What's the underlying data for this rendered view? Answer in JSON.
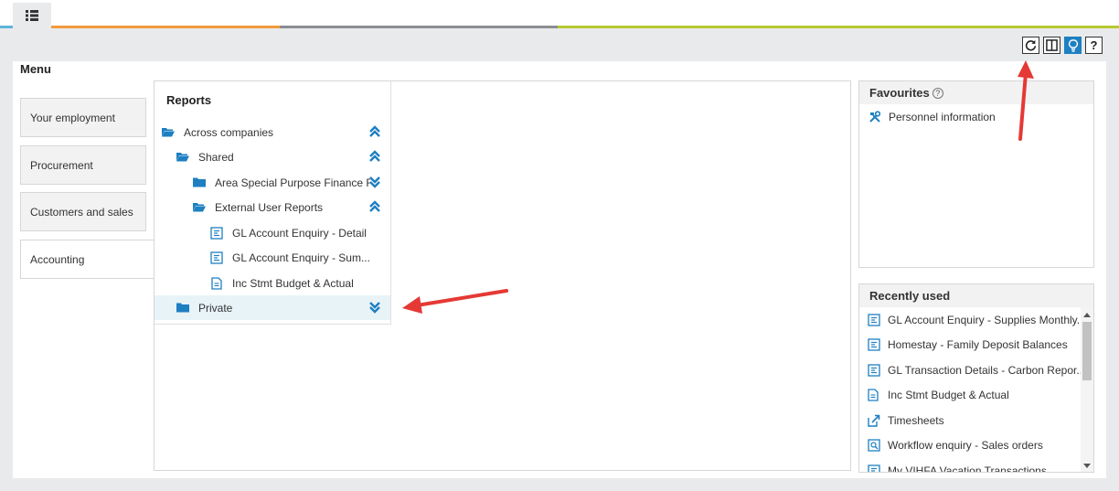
{
  "menu": {
    "title": "Menu"
  },
  "nav": {
    "items": [
      {
        "label": "Your employment"
      },
      {
        "label": "Procurement"
      },
      {
        "label": "Customers and sales"
      },
      {
        "label": "Accounting"
      }
    ],
    "active": "Accounting"
  },
  "reports": {
    "title": "Reports",
    "tree": [
      {
        "label": "Across companies",
        "type": "folder-open",
        "chevron": "up"
      },
      {
        "label": "Shared",
        "type": "folder-open",
        "chevron": "up"
      },
      {
        "label": "Area Special Purpose Finance R...",
        "type": "folder",
        "chevron": "down"
      },
      {
        "label": "External User Reports",
        "type": "folder-open",
        "chevron": "up"
      },
      {
        "label": "GL Account Enquiry - Detail",
        "type": "report"
      },
      {
        "label": "GL Account Enquiry - Sum...",
        "type": "report"
      },
      {
        "label": "Inc Stmt Budget & Actual",
        "type": "document"
      },
      {
        "label": "Private",
        "type": "folder",
        "chevron": "down",
        "highlighted": true
      }
    ]
  },
  "favourites": {
    "title": "Favourites",
    "help": "?",
    "items": [
      {
        "label": "Personnel information",
        "icon": "tools-icon"
      }
    ]
  },
  "recent": {
    "title": "Recently used",
    "items": [
      {
        "label": "GL Account Enquiry - Supplies Monthly...",
        "icon": "report-icon"
      },
      {
        "label": "Homestay - Family Deposit Balances",
        "icon": "report-icon"
      },
      {
        "label": "GL Transaction Details - Carbon Repor...",
        "icon": "report-icon"
      },
      {
        "label": "Inc Stmt Budget & Actual",
        "icon": "document-icon"
      },
      {
        "label": "Timesheets",
        "icon": "external-link-icon"
      },
      {
        "label": "Workflow enquiry - Sales orders",
        "icon": "enquiry-icon"
      },
      {
        "label": "My VIHFA Vacation Transactions",
        "icon": "report-icon"
      }
    ]
  },
  "toolbar": {
    "help": "?"
  },
  "colors": {
    "accent": "#1e7fc1",
    "arrow": "#e53935"
  }
}
